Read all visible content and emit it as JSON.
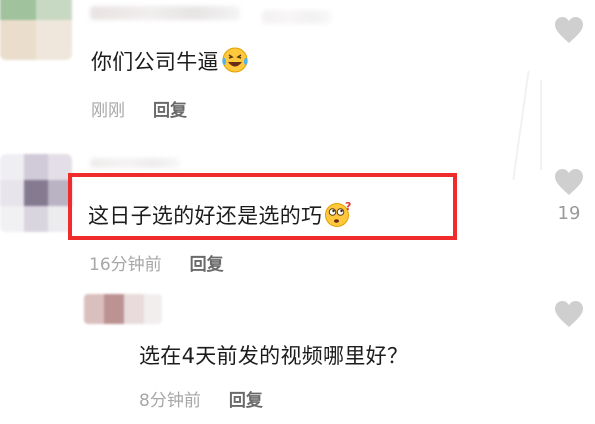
{
  "comments": [
    {
      "text": "你们公司牛逼",
      "emoji": "laughing-crying-emoji",
      "time": "刚刚",
      "reply": "回复",
      "likes": ""
    },
    {
      "text": "这日子选的好还是选的巧",
      "emoji": "dizzy-face-emoji",
      "time": "16分钟前",
      "reply": "回复",
      "likes": "19"
    },
    {
      "text": "选在4天前发的视频哪里好？",
      "emoji": "",
      "time": "8分钟前",
      "reply": "回复",
      "likes": ""
    }
  ],
  "colors": {
    "highlight_border": "#ef2b2b",
    "heart": "#cfcfcf",
    "time": "#a7a7a7",
    "reply": "#6a6a6a"
  }
}
